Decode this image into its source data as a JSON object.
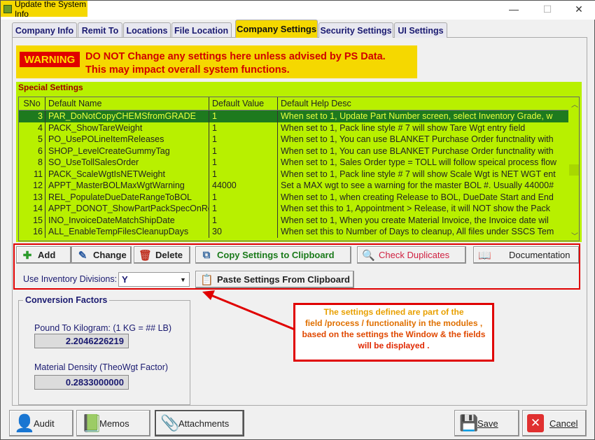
{
  "window": {
    "title": "Update the System Info",
    "controls": [
      "minimize",
      "maximize",
      "close"
    ]
  },
  "tabs": [
    {
      "label": "Company Info",
      "active": false
    },
    {
      "label": "Remit To",
      "active": false
    },
    {
      "label": "Locations",
      "active": false
    },
    {
      "label": "File Location",
      "active": false
    },
    {
      "label": "Company Settings",
      "active": true
    },
    {
      "label": "Security Settings",
      "active": false
    },
    {
      "label": "UI Settings",
      "active": false
    }
  ],
  "warning": {
    "badge": "WARNING",
    "line1": "DO NOT Change any settings here unless advised by PS Data.",
    "line2": "This may impact overall system functions."
  },
  "special": {
    "label": "Special Settings",
    "columns": [
      "SNo",
      "Default Name",
      "Default Value",
      "Default Help Desc"
    ],
    "rows": [
      {
        "sno": "3",
        "name": "PAR_DoNotCopyCHEMSfromGRADE",
        "value": "1",
        "desc": "When set to 1, Update Part Number screen, select Inventory Grade, w",
        "selected": true
      },
      {
        "sno": "4",
        "name": "PACK_ShowTareWeight",
        "value": "1",
        "desc": "When set to 1, Pack line style # 7 will show Tare Wgt entry field"
      },
      {
        "sno": "5",
        "name": "PO_UsePOLineItemReleases",
        "value": "1",
        "desc": "When set to 1, You can use BLANKET Purchase Order functnality with"
      },
      {
        "sno": "6",
        "name": "SHOP_LevelCreateGummyTag",
        "value": "1",
        "desc": "When set to 1, You can use BLANKET Purchase Order functnality with"
      },
      {
        "sno": "8",
        "name": "SO_UseTollSalesOrder",
        "value": "1",
        "desc": "When set to 1, Sales Order type = TOLL will follow speical process flow"
      },
      {
        "sno": "11",
        "name": "PACK_ScaleWgtIsNETWeight",
        "value": "1",
        "desc": "When set to 1, Pack line style # 7 will show Scale Wgt is NET WGT ent"
      },
      {
        "sno": "12",
        "name": "APPT_MasterBOLMaxWgtWarning",
        "value": "44000",
        "desc": "Set a MAX wgt to see a warning for the master BOL #. Usually 44000#"
      },
      {
        "sno": "13",
        "name": "REL_PopulateDueDateRangeToBOL",
        "value": "1",
        "desc": "When set to 1, when creating Release to BOL, DueDate Start and End"
      },
      {
        "sno": "14",
        "name": "APPT_DONOT_ShowPartPackSpecOnRe",
        "value": "1",
        "desc": "When set this to 1, Appointment > Release, it will NOT show the Pack"
      },
      {
        "sno": "15",
        "name": "INO_InvoiceDateMatchShipDate",
        "value": "1",
        "desc": "When set to 1, When you create Material Invoice, the Invoice date wil"
      },
      {
        "sno": "16",
        "name": "ALL_EnableTempFilesCleanupDays",
        "value": "30",
        "desc": "When set this to Number of Days to cleanup, All files under SSCS Tem"
      }
    ]
  },
  "actions": {
    "add": "Add",
    "change": "Change",
    "delete": "Delete",
    "copy": "Copy Settings to Clipboard",
    "check": "Check Duplicates",
    "documentation": "Documentation",
    "paste": "Paste Settings From Clipboard",
    "inv_div_label": "Use Inventory Divisions:",
    "inv_div_value": "Y"
  },
  "conversion": {
    "title": "Conversion Factors",
    "lb_label": "Pound To Kilogram: (1 KG = ## LB)",
    "lb_value": "2.2046226219",
    "density_label": "Material Density (TheoWgt Factor)",
    "density_value": "0.2833000000"
  },
  "annotation": {
    "line1": "The settings defined are part of the",
    "line2": "field /process / functionality in the modules ,",
    "line3": "based on the settings the Window & the fields",
    "line4": "will be displayed ."
  },
  "footer": {
    "audit": "Audit",
    "memos": "Memos",
    "attachments": "Attachments",
    "save": "Save",
    "cancel": "Cancel"
  },
  "colors": {
    "accent": "#f5d800",
    "grid_bg": "#b8f000",
    "selected_row": "#1e7a1e",
    "warning": "#e00000"
  }
}
